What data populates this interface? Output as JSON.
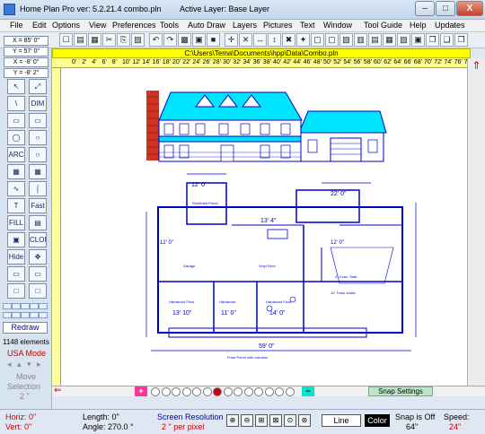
{
  "window": {
    "title_app": "Home Plan Pro ver: 5.2.21.4",
    "title_file": "combo.pln",
    "title_layer": "Active Layer: Base Layer",
    "min_label": "–",
    "max_label": "□",
    "close_label": "X"
  },
  "menu": [
    "File",
    "Edit",
    "Options",
    "View",
    "Preferences",
    "Tools",
    "Auto Draw",
    "Layers",
    "Pictures",
    "Text",
    "Window",
    "Tool Guide",
    "Help",
    "Updates"
  ],
  "toolbar": [
    "☐",
    "▤",
    "▦",
    "✂",
    "⎘",
    "▨",
    "↶",
    "↷",
    "▩",
    "▣",
    "■",
    "✛",
    "✕",
    "↔",
    "↕",
    "✖",
    "✦",
    "▢",
    "▢",
    "▧",
    "▥",
    "▤",
    "▦",
    "▧",
    "▣",
    "❐",
    "❑",
    "❒"
  ],
  "coords": {
    "x": "X = 85' 0\"",
    "y": "Y = 57' 0\""
  },
  "coords2": {
    "x": "X = -8' 0\"",
    "y": "Y = -8' 2\""
  },
  "tools": [
    [
      "↖",
      "⤢"
    ],
    [
      "\\",
      "DIM"
    ],
    [
      "▭",
      "▭"
    ],
    [
      "◯",
      "○"
    ],
    [
      "ARC",
      "○"
    ],
    [
      "▦",
      "▦"
    ],
    [
      "∿",
      "⌠"
    ],
    [
      "T",
      "Fast"
    ],
    [
      "FILL",
      "▤"
    ],
    [
      "▣",
      "CLONE"
    ],
    [
      "Hide",
      "✥"
    ],
    [
      "▭",
      "▭"
    ],
    [
      "□",
      "□"
    ]
  ],
  "redraw_label": "Redraw",
  "elements_count": "1148 elements",
  "mode": "USA Mode",
  "move_label": "Move",
  "selection_label": "Selection",
  "selection_value": "2 \"",
  "path": "C:\\Users\\Tema\\Documents\\hpp\\Data\\Combo.pln",
  "ruler": [
    "0'",
    "2'",
    "4'",
    "6'",
    "8'",
    "10'",
    "12'",
    "14'",
    "16'",
    "18'",
    "20'",
    "22'",
    "24'",
    "26'",
    "28'",
    "30'",
    "32'",
    "34'",
    "36'",
    "38'",
    "40'",
    "42'",
    "44'",
    "46'",
    "48'",
    "50'",
    "52'",
    "54'",
    "56'",
    "58'",
    "60'",
    "62'",
    "64'",
    "66'",
    "68'",
    "70'",
    "72'",
    "74'",
    "76'",
    "78'",
    "80'",
    "82'",
    "84'"
  ],
  "floorplan": {
    "dims": [
      "12' 0\"",
      "22' 0\"",
      "13' 4\"",
      "12' 0\"",
      "12' 0\"",
      "13' 10\"",
      "11' 0\"",
      "14' 0\"",
      "59' 0\"",
      "2' 0\"",
      "6' 0\"",
      "4' 0\"",
      "5' 6\"",
      "8' 0\""
    ],
    "rooms": [
      "Screened Porch",
      "Garage",
      "Hardwood Floor",
      "Hardwood",
      "Hardwood Floor",
      "Vinyl Floor",
      "4\" Conc. Slab",
      "12' Truss Joists",
      "Front Porch with columns"
    ]
  },
  "bottom": {
    "plus": "+",
    "minus": "−",
    "snap_settings": "Snap Settings"
  },
  "status": {
    "horiz": "Horiz: 0\"",
    "vert": "Vert: 0\"",
    "length": "Length: 0\"",
    "angle": "Angle: 270.0 °",
    "screen_res_label": "Screen Resolution",
    "screen_res_value": "2 \" per pixel",
    "line_label": "Line",
    "color_label": "Color",
    "snap_label": "Snap is Off",
    "snap_value": "64\"",
    "speed_label": "Speed:",
    "speed_value": "24\""
  },
  "colors": {
    "roof": "#00e5ff",
    "brick": "#cc3322",
    "plan": "#0000cc",
    "pathbar": "#ffff00"
  }
}
